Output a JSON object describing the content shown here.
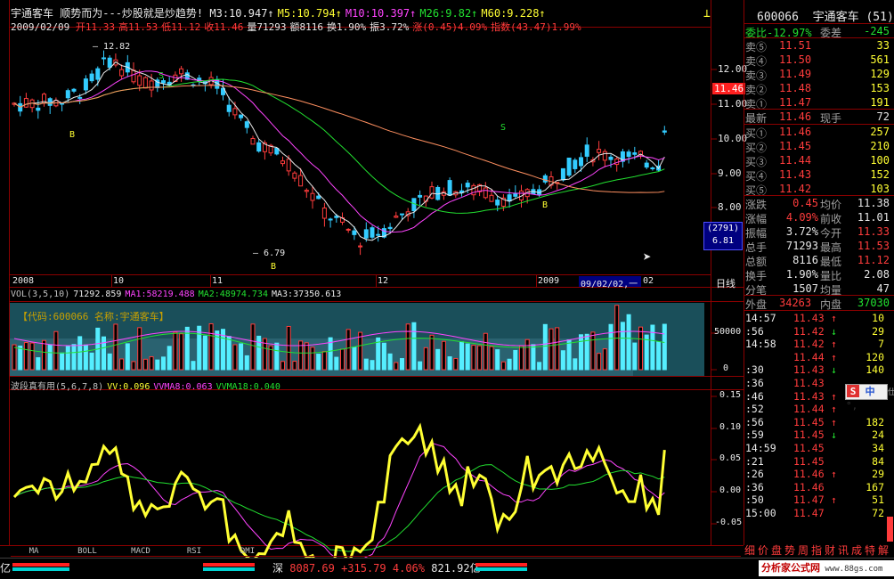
{
  "header": {
    "name": "宇通客车",
    "slogan": "顺势而为---炒股就是炒趋势!",
    "ma_line": [
      {
        "label": "M3:10.947",
        "color": "#e8e8e8"
      },
      {
        "label": "M5:10.794",
        "color": "#ffff33"
      },
      {
        "label": "M10:10.397",
        "color": "#ff44ff"
      },
      {
        "label": "M26:9.82",
        "color": "#22e030"
      },
      {
        "label": "M60:9.228",
        "color": "#ffff33"
      }
    ],
    "date": "2009/02/09",
    "ohlc": [
      {
        "label": "开11.33",
        "color": "#ff3c3c"
      },
      {
        "label": "高11.53",
        "color": "#ff3c3c"
      },
      {
        "label": "低11.12",
        "color": "#ff3c3c"
      },
      {
        "label": "收11.46",
        "color": "#ff3c3c"
      },
      {
        "label": "量71293",
        "color": "#e8e8e8"
      },
      {
        "label": "额8116",
        "color": "#e8e8e8"
      },
      {
        "label": "换1.90%",
        "color": "#e8e8e8"
      },
      {
        "label": "振3.72%",
        "color": "#e8e8e8"
      },
      {
        "label": "涨(0.45)4.09%",
        "color": "#ff3c3c"
      },
      {
        "label": "指数(43.47)1.99%",
        "color": "#ff3c3c"
      }
    ]
  },
  "price_chart": {
    "y_ticks": [
      "12.00",
      "11.00",
      "10.00",
      "9.00",
      "8.00"
    ],
    "current_price_tag": "11.46",
    "cursor_box_top": "(2791)",
    "cursor_box_bottom": "6.81",
    "annotations": {
      "high_label": "12.82",
      "low_label": "6.79",
      "b1": "B",
      "b2": "B",
      "b3": "B",
      "s1": "S",
      "s2": "S"
    },
    "x_labels": [
      "2008",
      "10",
      "11",
      "12",
      "2009"
    ],
    "cursor_date": "09/02/02,一",
    "cursor_after": "02",
    "period_label": "日线"
  },
  "volume_panel": {
    "header": [
      {
        "label": "VOL(3,5,10)",
        "color": "#c0c0c0"
      },
      {
        "label": "71292.859",
        "color": "#e8e8e8"
      },
      {
        "label": "MA1:58219.488",
        "color": "#ff44ff"
      },
      {
        "label": "MA2:48974.734",
        "color": "#22e030"
      },
      {
        "label": "MA3:37350.613",
        "color": "#e8e8e8"
      }
    ],
    "info_box": "【代码:600066 名称:宇通客车】",
    "y_ticks": [
      "50000",
      "0"
    ]
  },
  "indicator_panel": {
    "header": [
      {
        "label": "波段真有用(5,6,7,8)",
        "color": "#c0c0c0"
      },
      {
        "label": "VV:0.096",
        "color": "#ffff33"
      },
      {
        "label": "VVMA8:0.063",
        "color": "#ff44ff"
      },
      {
        "label": "VVMA18:0.040",
        "color": "#22e030"
      }
    ],
    "y_ticks": [
      "0.15",
      "0.10",
      "0.05",
      "0.00",
      "-0.05"
    ]
  },
  "tabs": [
    "MA",
    "BOLL",
    "MACD",
    "RSI",
    "DMI"
  ],
  "right_panel": {
    "code": "600066",
    "name": "宇通客车",
    "weibi": "委比-12.97%",
    "weicha_label": "委差",
    "weicha": "-245",
    "asks": [
      {
        "label": "卖⑤",
        "price": "11.51",
        "vol": "33"
      },
      {
        "label": "卖④",
        "price": "11.50",
        "vol": "561"
      },
      {
        "label": "卖③",
        "price": "11.49",
        "vol": "129"
      },
      {
        "label": "卖②",
        "price": "11.48",
        "vol": "153"
      },
      {
        "label": "卖①",
        "price": "11.47",
        "vol": "191"
      }
    ],
    "last": {
      "label": "最新",
      "price": "11.46",
      "label2": "现手",
      "vol": "72"
    },
    "bids": [
      {
        "label": "买①",
        "price": "11.46",
        "vol": "257"
      },
      {
        "label": "买②",
        "price": "11.45",
        "vol": "210"
      },
      {
        "label": "买③",
        "price": "11.44",
        "vol": "100"
      },
      {
        "label": "买④",
        "price": "11.43",
        "vol": "152"
      },
      {
        "label": "买⑤",
        "price": "11.42",
        "vol": "103"
      }
    ],
    "stats": [
      {
        "l1": "涨跌",
        "v1": "0.45",
        "l2": "均价",
        "v2": "11.38",
        "c1": "#ff3c3c",
        "c2": "#e8e8e8"
      },
      {
        "l1": "涨幅",
        "v1": "4.09%",
        "l2": "前收",
        "v2": "11.01",
        "c1": "#ff3c3c",
        "c2": "#e8e8e8"
      },
      {
        "l1": "振幅",
        "v1": "3.72%",
        "l2": "今开",
        "v2": "11.33",
        "c1": "#e8e8e8",
        "c2": "#ff3c3c"
      },
      {
        "l1": "总手",
        "v1": "71293",
        "l2": "最高",
        "v2": "11.53",
        "c1": "#e8e8e8",
        "c2": "#ff3c3c"
      },
      {
        "l1": "总额",
        "v1": "8116",
        "l2": "最低",
        "v2": "11.12",
        "c1": "#e8e8e8",
        "c2": "#ff3c3c"
      },
      {
        "l1": "换手",
        "v1": "1.90%",
        "l2": "量比",
        "v2": "2.08",
        "c1": "#e8e8e8",
        "c2": "#e8e8e8"
      },
      {
        "l1": "分笔",
        "v1": "1507",
        "l2": "均量",
        "v2": "47",
        "c1": "#e8e8e8",
        "c2": "#e8e8e8"
      }
    ],
    "outer_label": "外盘",
    "outer": "34263",
    "inner_label": "内盘",
    "inner": "37030",
    "ticks": [
      {
        "time": "14:57",
        "price": "11.43",
        "arrow": "↑",
        "vol": "10",
        "dir": "up"
      },
      {
        "time": ":56",
        "price": "11.42",
        "arrow": "↓",
        "vol": "29",
        "dir": "down"
      },
      {
        "time": "14:58",
        "price": "11.42",
        "arrow": "↑",
        "vol": "7",
        "dir": "up"
      },
      {
        "time": "",
        "price": "11.44",
        "arrow": "↑",
        "vol": "120",
        "dir": "up"
      },
      {
        "time": ":30",
        "price": "11.43",
        "arrow": "↓",
        "vol": "140",
        "dir": "down"
      },
      {
        "time": ":36",
        "price": "11.43",
        "arrow": "",
        "vol": "",
        "dir": "up"
      },
      {
        "time": ":46",
        "price": "11.43",
        "arrow": "↑",
        "vol": "",
        "dir": "up"
      },
      {
        "time": ":52",
        "price": "11.44",
        "arrow": "↑",
        "vol": "",
        "dir": "up"
      },
      {
        "time": ":56",
        "price": "11.45",
        "arrow": "↑",
        "vol": "182",
        "dir": "up"
      },
      {
        "time": ":59",
        "price": "11.45",
        "arrow": "↓",
        "vol": "24",
        "dir": "down"
      },
      {
        "time": "14:59",
        "price": "11.45",
        "arrow": "",
        "vol": "34",
        "dir": "up"
      },
      {
        "time": ":21",
        "price": "11.45",
        "arrow": "",
        "vol": "84",
        "dir": "up"
      },
      {
        "time": ":26",
        "price": "11.46",
        "arrow": "↑",
        "vol": "29",
        "dir": "up"
      },
      {
        "time": ":36",
        "price": "11.46",
        "arrow": "",
        "vol": "167",
        "dir": "up"
      },
      {
        "time": ":50",
        "price": "11.47",
        "arrow": "↑",
        "vol": "51",
        "dir": "up"
      },
      {
        "time": "15:00",
        "price": "11.47",
        "arrow": "",
        "vol": "72",
        "dir": "up"
      }
    ],
    "bottom_tabs": [
      "细",
      "价",
      "盘",
      "势",
      "周",
      "指",
      "财",
      "讯",
      "成",
      "特",
      "解"
    ]
  },
  "ime": {
    "s": "S",
    "lang": "中"
  },
  "status_bar": {
    "left_unit": "亿",
    "market": "深",
    "index": "8087.69",
    "change": "+315.79",
    "pct": "4.06%",
    "amount": "821.92亿",
    "watermark": "分析家公式网",
    "watermark_url": "www.88gs.com"
  }
}
